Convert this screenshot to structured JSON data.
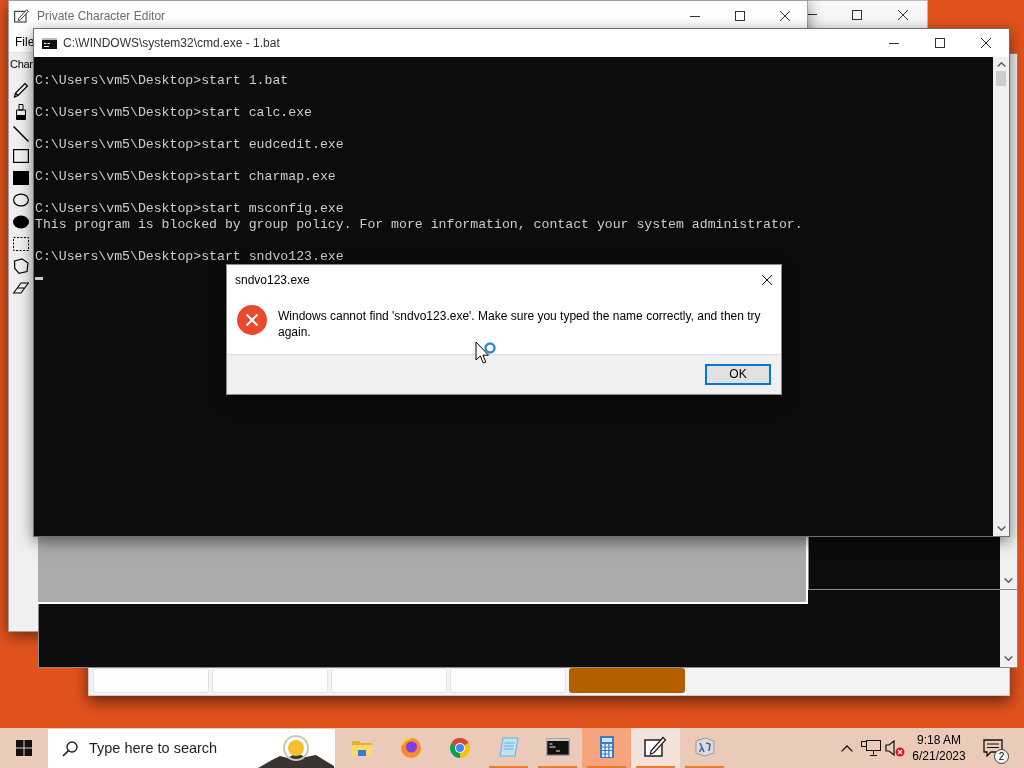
{
  "editor_window": {
    "title": "Private Character Editor",
    "menu": [
      "File"
    ],
    "toolbar_label": "Char",
    "tools": [
      {
        "kind": "pencil"
      },
      {
        "kind": "brush"
      },
      {
        "kind": "line"
      },
      {
        "kind": "rectangle"
      },
      {
        "kind": "filled_rectangle"
      },
      {
        "kind": "ellipse"
      },
      {
        "kind": "filled_ellipse"
      },
      {
        "kind": "rect_select"
      },
      {
        "kind": "freeform_select"
      },
      {
        "kind": "eraser"
      }
    ]
  },
  "calculator_window": {
    "keys": [
      {
        "kind": "plain"
      },
      {
        "kind": "plain"
      },
      {
        "kind": "plain"
      },
      {
        "kind": "plain"
      },
      {
        "kind": "accent"
      }
    ]
  },
  "cmd_window": {
    "title": "C:\\WINDOWS\\system32\\cmd.exe - 1.bat",
    "console_blocks": [
      [
        "C:\\Users\\vm5\\Desktop>start 1.bat"
      ],
      [
        "C:\\Users\\vm5\\Desktop>start calc.exe"
      ],
      [
        "C:\\Users\\vm5\\Desktop>start eudcedit.exe"
      ],
      [
        "C:\\Users\\vm5\\Desktop>start charmap.exe"
      ],
      [
        "C:\\Users\\vm5\\Desktop>start msconfig.exe",
        "This program is blocked by group policy. For more information, contact your system administrator."
      ],
      [
        "C:\\Users\\vm5\\Desktop>start sndvo123.exe"
      ]
    ]
  },
  "dialog": {
    "title": "sndvo123.exe",
    "message": "Windows cannot find 'sndvo123.exe'. Make sure you typed the name correctly, and then try again.",
    "buttons": [
      {
        "label": "OK",
        "default": true
      }
    ]
  },
  "taskbar": {
    "search": {
      "placeholder": "Type here to search"
    },
    "apps": [
      {
        "kind": "folder",
        "running": false,
        "selected": false,
        "hovered": false
      },
      {
        "kind": "fox_globe",
        "running": false,
        "selected": false,
        "hovered": false
      },
      {
        "kind": "segmented_circle",
        "running": false,
        "selected": false,
        "hovered": false
      },
      {
        "kind": "notepad",
        "running": true,
        "selected": false,
        "hovered": false
      },
      {
        "kind": "terminal",
        "running": true,
        "selected": false,
        "hovered": false
      },
      {
        "kind": "calculator",
        "running": true,
        "selected": true,
        "hovered": false
      },
      {
        "kind": "pen_pad",
        "running": true,
        "selected": false,
        "hovered": true
      },
      {
        "kind": "lambda_cube",
        "running": true,
        "selected": false,
        "hovered": false
      }
    ],
    "tray": {
      "volume_muted": true,
      "time": "9:18 AM",
      "date": "6/21/2023",
      "notification_count": "2"
    }
  }
}
